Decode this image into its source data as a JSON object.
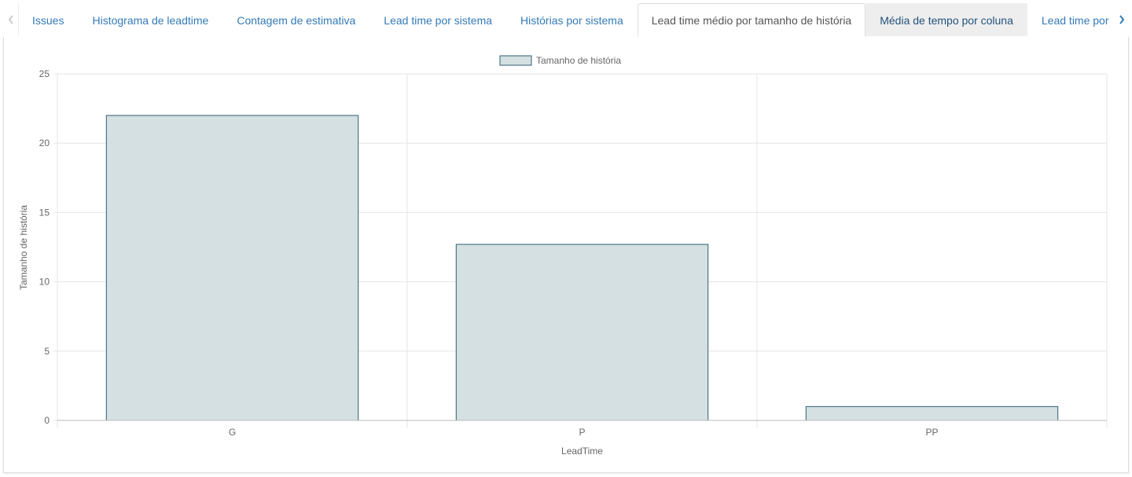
{
  "tabs": [
    {
      "label": "Issues",
      "state": "normal"
    },
    {
      "label": "Histograma de leadtime",
      "state": "normal"
    },
    {
      "label": "Contagem de estimativa",
      "state": "normal"
    },
    {
      "label": "Lead time por sistema",
      "state": "normal"
    },
    {
      "label": "Histórias por sistema",
      "state": "normal"
    },
    {
      "label": "Lead time médio por tamanho de história",
      "state": "active"
    },
    {
      "label": "Média de tempo por coluna",
      "state": "hover"
    },
    {
      "label": "Lead time por ",
      "state": "normal"
    }
  ],
  "icons": {
    "left_arrow": "chevron-left-icon",
    "right_arrow": "chevron-right-icon"
  },
  "colors": {
    "link": "#337ab7",
    "bar_fill": "#d4e0e1",
    "bar_stroke": "#2e5f73",
    "grid": "#e6e6e6"
  },
  "chart_data": {
    "type": "bar",
    "categories": [
      "G",
      "P",
      "PP"
    ],
    "series": [
      {
        "name": "Tamanho de história",
        "values": [
          22,
          12.7,
          1
        ]
      }
    ],
    "xlabel": "LeadTime",
    "ylabel": "Tamanho de história",
    "ylim": [
      0,
      25
    ],
    "yticks": [
      0,
      5,
      10,
      15,
      20,
      25
    ],
    "grid": true,
    "legend_position": "top-center"
  }
}
